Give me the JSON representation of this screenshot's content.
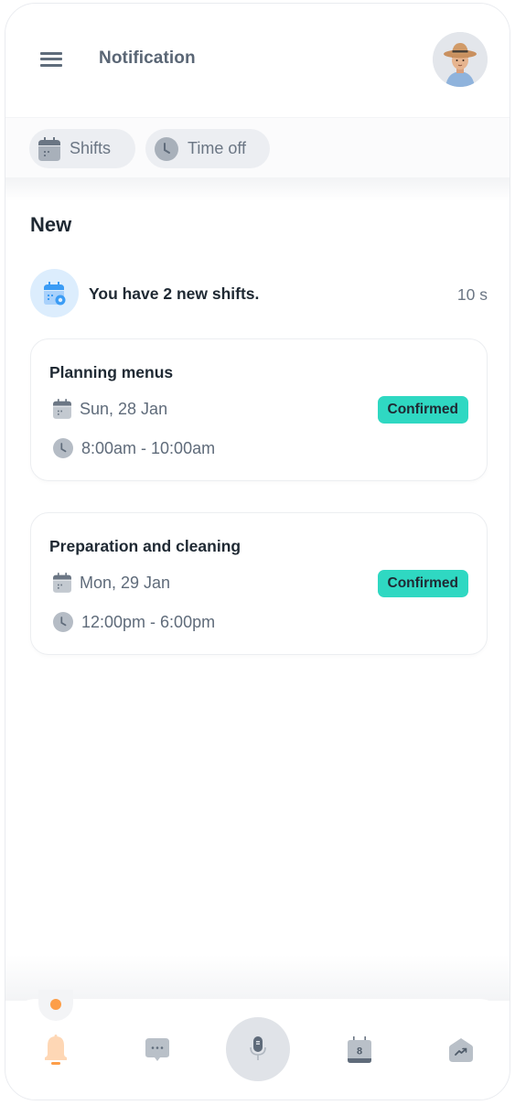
{
  "header": {
    "title": "Notification",
    "menu_icon": "hamburger-menu-icon",
    "avatar": "user-avatar"
  },
  "filters": [
    {
      "label": "Shifts",
      "icon": "calendar-icon"
    },
    {
      "label": "Time off",
      "icon": "clock-icon"
    }
  ],
  "section": {
    "title": "New"
  },
  "notification": {
    "text": "You have 2 new shifts.",
    "time": "10 s",
    "icon": "calendar-settings-icon"
  },
  "shifts": [
    {
      "title": "Planning menus",
      "date": "Sun, 28 Jan",
      "time": "8:00am - 10:00am",
      "status": "Confirmed"
    },
    {
      "title": "Preparation and cleaning",
      "date": "Mon, 29 Jan",
      "time": "12:00pm - 6:00pm",
      "status": "Confirmed"
    }
  ],
  "bottom_nav": {
    "items": [
      {
        "name": "notifications",
        "icon": "bell-icon",
        "active": true
      },
      {
        "name": "messages",
        "icon": "chat-bubble-icon",
        "active": false
      },
      {
        "name": "voice",
        "icon": "microphone-icon",
        "active": false
      },
      {
        "name": "calendar",
        "icon": "calendar-day-icon",
        "calendar_day": "8",
        "active": false
      },
      {
        "name": "stats",
        "icon": "trend-home-icon",
        "active": false
      }
    ]
  },
  "colors": {
    "accent_orange": "#fd9e48",
    "bell_fill": "#fed7b5",
    "badge_teal": "#2fd8c2",
    "notif_icon_bg": "#dcedfd",
    "notif_icon_blue": "#3b9cf5",
    "icon_gray": "#9aa3ad",
    "text_dark": "#1f2933",
    "text_muted": "#6b7684"
  }
}
